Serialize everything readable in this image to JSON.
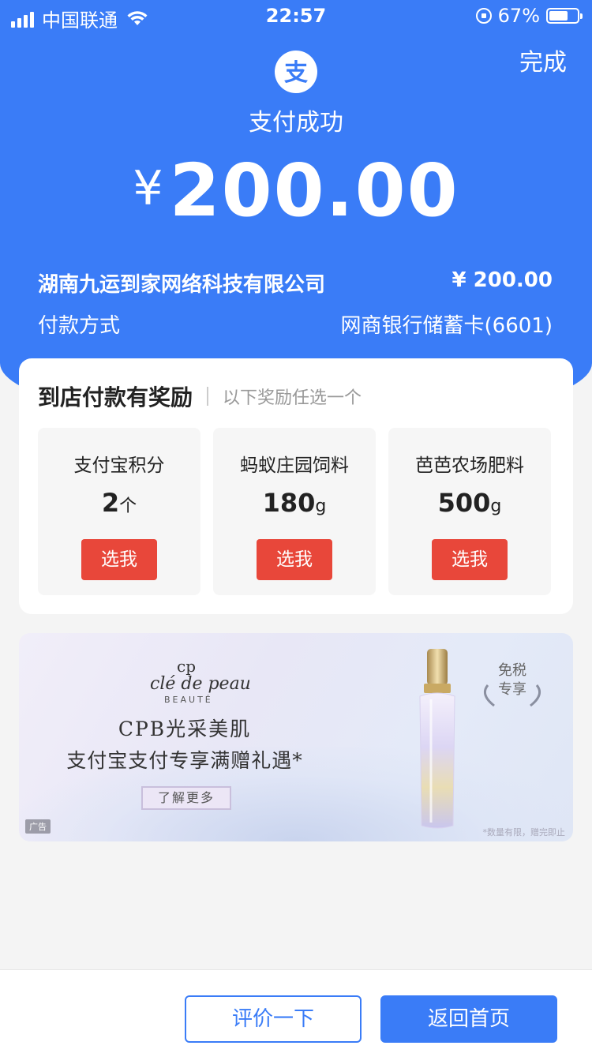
{
  "status_bar": {
    "carrier": "中国联通",
    "time": "22:57",
    "battery_percent_label": "67%",
    "battery_level": 0.67
  },
  "header": {
    "done_label": "完成",
    "status_title": "支付成功",
    "currency_symbol": "¥",
    "amount": "200.00",
    "accent_color": "#3a7cf7"
  },
  "details": {
    "merchant_name": "湖南九运到家网络科技有限公司",
    "merchant_amount": "¥ 200.00",
    "method_label": "付款方式",
    "method_value": "网商银行储蓄卡(6601)"
  },
  "rewards": {
    "title": "到店付款有奖励",
    "subtitle": "以下奖励任选一个",
    "options": [
      {
        "name": "支付宝积分",
        "qty": "2",
        "unit": "个",
        "button": "选我"
      },
      {
        "name": "蚂蚁庄园饲料",
        "qty": "180",
        "unit": "g",
        "button": "选我"
      },
      {
        "name": "芭芭农场肥料",
        "qty": "500",
        "unit": "g",
        "button": "选我"
      }
    ],
    "button_color": "#e8473a"
  },
  "ad": {
    "logo_mark": "cp",
    "brand": "clé de peau",
    "brand_sub": "BEAUTÉ",
    "line1": "CPB光采美肌",
    "line2": "支付宝支付专享满赠礼遇*",
    "more_label": "了解更多",
    "tag": "广告",
    "badge_line1": "免税",
    "badge_line2": "专享",
    "note": "*数量有限，赠完即止"
  },
  "bottom_bar": {
    "rate_label": "评价一下",
    "home_label": "返回首页"
  }
}
